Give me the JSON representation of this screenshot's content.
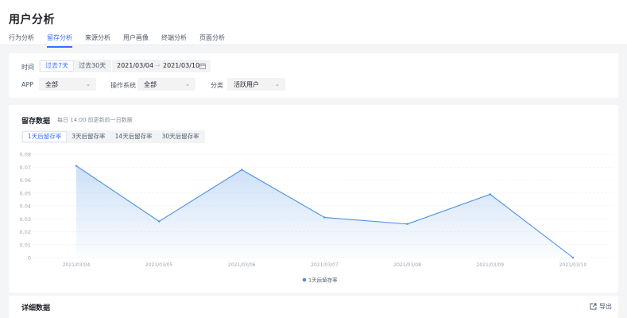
{
  "header": {
    "title": "用户分析",
    "tabs": [
      "行为分析",
      "留存分析",
      "来源分析",
      "用户画像",
      "终端分析",
      "页面分析"
    ],
    "active_tab": 1
  },
  "filters": {
    "quick_range": [
      "过去7天",
      "过去30天"
    ],
    "quick_active": 0,
    "date_start": "2021/03/04",
    "date_end": "2021/03/10",
    "date_sep": "→",
    "app_label": "APP",
    "app_value": "全部",
    "os_label": "操作系统",
    "os_value": "全部",
    "category_label": "分类",
    "category_value": "活跃用户"
  },
  "retention": {
    "title": "留存数据",
    "subtitle": "每日 14:00 前更新前一日数据",
    "rate_tabs": [
      "1天后留存率",
      "3天后留存率",
      "14天后留存率",
      "30天后留存率"
    ],
    "rate_active": 0
  },
  "chart_data": {
    "type": "area",
    "x": [
      "2021/03/04",
      "2021/03/05",
      "2021/03/06",
      "2021/03/07",
      "2021/03/08",
      "2021/03/09",
      "2021/03/10"
    ],
    "series": [
      {
        "name": "1天后留存率",
        "values": [
          0.071,
          0.028,
          0.068,
          0.031,
          0.026,
          0.049,
          0.0
        ]
      }
    ],
    "ylim": [
      0,
      0.08
    ],
    "yticks": [
      "0",
      "0.01",
      "0.02",
      "0.03",
      "0.04",
      "0.05",
      "0.06",
      "0.07",
      "0.08"
    ],
    "grid": true,
    "legend": "bottom-center",
    "color": "#4a90e2"
  },
  "detail": {
    "title": "详细数据",
    "export_label": "导出"
  }
}
